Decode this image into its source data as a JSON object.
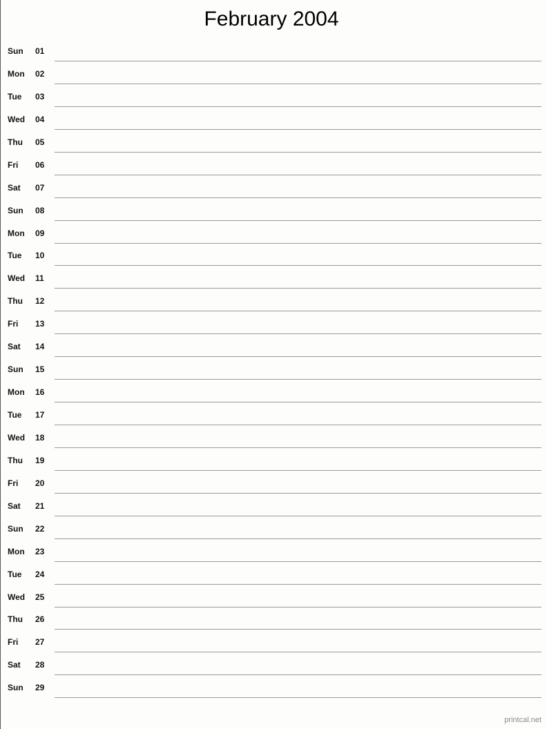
{
  "page": {
    "title": "February 2004",
    "background_color": "#fdfefc",
    "rule_color": "#9a9a96",
    "text_color": "#111111"
  },
  "footer": {
    "credit": "printcal.net",
    "color": "#8a8a86"
  },
  "calendar": {
    "month": "February",
    "year": "2004",
    "days": [
      {
        "weekday": "Sun",
        "number": "01"
      },
      {
        "weekday": "Mon",
        "number": "02"
      },
      {
        "weekday": "Tue",
        "number": "03"
      },
      {
        "weekday": "Wed",
        "number": "04"
      },
      {
        "weekday": "Thu",
        "number": "05"
      },
      {
        "weekday": "Fri",
        "number": "06"
      },
      {
        "weekday": "Sat",
        "number": "07"
      },
      {
        "weekday": "Sun",
        "number": "08"
      },
      {
        "weekday": "Mon",
        "number": "09"
      },
      {
        "weekday": "Tue",
        "number": "10"
      },
      {
        "weekday": "Wed",
        "number": "11"
      },
      {
        "weekday": "Thu",
        "number": "12"
      },
      {
        "weekday": "Fri",
        "number": "13"
      },
      {
        "weekday": "Sat",
        "number": "14"
      },
      {
        "weekday": "Sun",
        "number": "15"
      },
      {
        "weekday": "Mon",
        "number": "16"
      },
      {
        "weekday": "Tue",
        "number": "17"
      },
      {
        "weekday": "Wed",
        "number": "18"
      },
      {
        "weekday": "Thu",
        "number": "19"
      },
      {
        "weekday": "Fri",
        "number": "20"
      },
      {
        "weekday": "Sat",
        "number": "21"
      },
      {
        "weekday": "Sun",
        "number": "22"
      },
      {
        "weekday": "Mon",
        "number": "23"
      },
      {
        "weekday": "Tue",
        "number": "24"
      },
      {
        "weekday": "Wed",
        "number": "25"
      },
      {
        "weekday": "Thu",
        "number": "26"
      },
      {
        "weekday": "Fri",
        "number": "27"
      },
      {
        "weekday": "Sat",
        "number": "28"
      },
      {
        "weekday": "Sun",
        "number": "29"
      }
    ]
  }
}
